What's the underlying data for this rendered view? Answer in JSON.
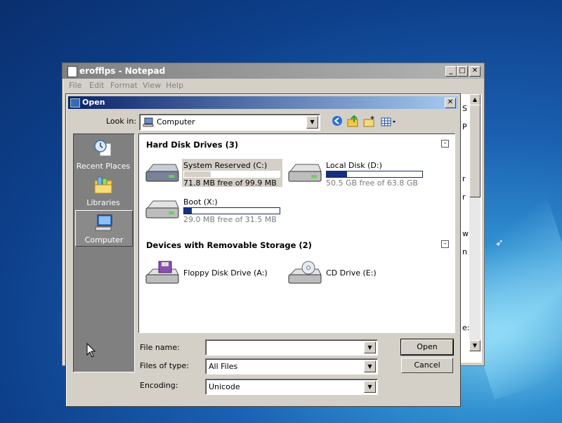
{
  "notepad": {
    "title": "erofflps - Notepad",
    "menu": [
      "File",
      "Edit",
      "Format",
      "View",
      "Help"
    ],
    "text_fragments": [
      "S",
      "P",
      "r",
      "r",
      "w",
      "n",
      "e:"
    ],
    "controls": {
      "minimize": "_",
      "maximize": "□",
      "close": "✕"
    }
  },
  "dialog": {
    "title": "Open",
    "close": "✕",
    "look_in_label": "Look in:",
    "look_in_value": "Computer",
    "places": [
      {
        "label": "Recent Places",
        "icon": "recent-places-icon"
      },
      {
        "label": "Libraries",
        "icon": "libraries-icon"
      },
      {
        "label": "Computer",
        "icon": "computer-icon",
        "selected": true
      }
    ],
    "groups": [
      {
        "title": "Hard Disk Drives (3)",
        "items": [
          {
            "name": "System Reserved (C:)",
            "free": "71.8 MB free of 99.9 MB",
            "used_fraction": 0.28,
            "selected": true
          },
          {
            "name": "Local Disk (D:)",
            "free": "50.5 GB free of 63.8 GB",
            "used_fraction": 0.21
          },
          {
            "name": "Boot (X:)",
            "free": "29.0 MB free of 31.5 MB",
            "used_fraction": 0.08
          }
        ]
      },
      {
        "title": "Devices with Removable Storage (2)",
        "items": [
          {
            "name": "Floppy Disk Drive (A:)",
            "icon": "floppy-drive-icon"
          },
          {
            "name": "CD Drive (E:)",
            "icon": "cd-drive-icon"
          }
        ]
      }
    ],
    "file_name_label": "File name:",
    "file_name_value": "",
    "files_of_type_label": "Files of type:",
    "files_of_type_value": "All Files",
    "encoding_label": "Encoding:",
    "encoding_value": "Unicode",
    "open_button": "Open",
    "cancel_button": "Cancel"
  }
}
